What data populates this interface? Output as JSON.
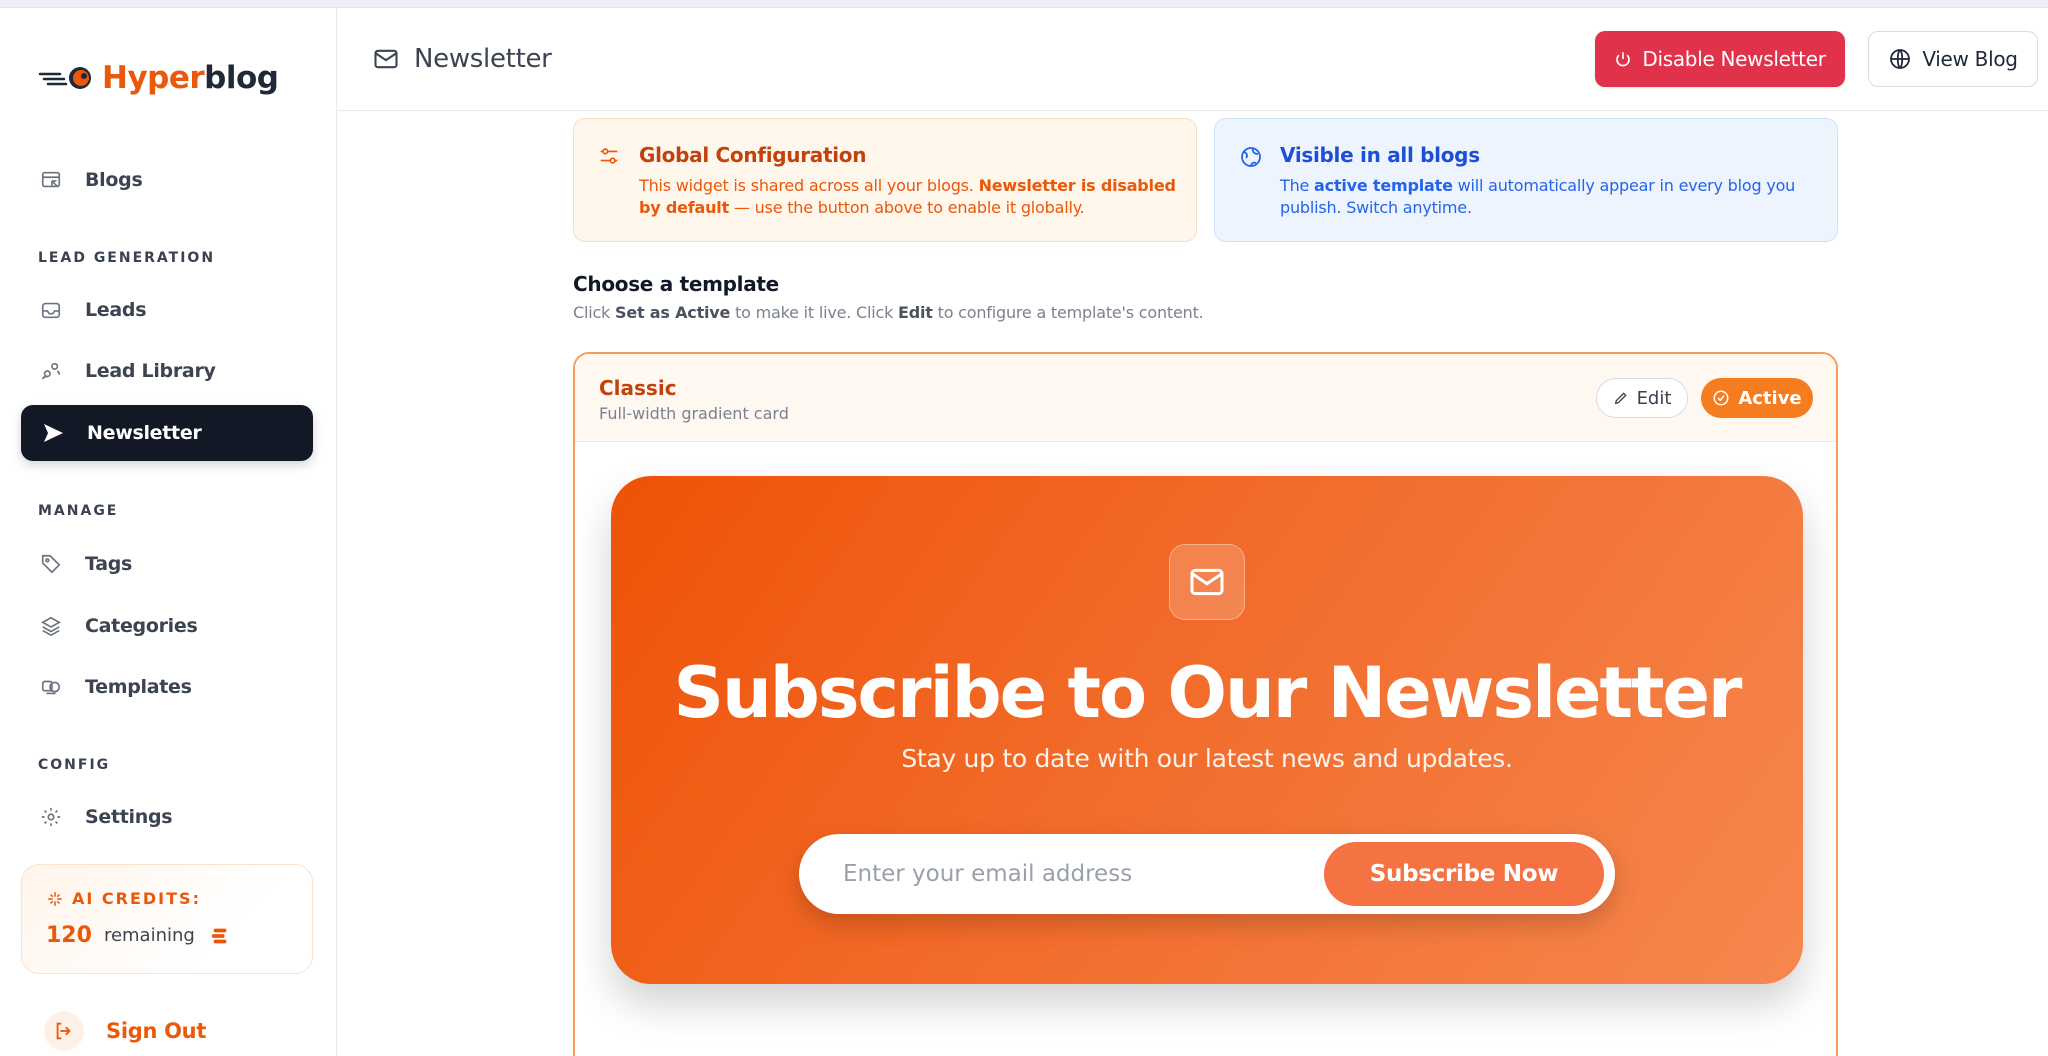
{
  "app": {
    "logo_prefix": "Hyper",
    "logo_suffix": "blog"
  },
  "sidebar": {
    "blogs": "Blogs",
    "sections": {
      "lead_generation": "LEAD GENERATION",
      "manage": "MANAGE",
      "config": "CONFIG"
    },
    "lead_generation_items": [
      {
        "label": "Leads",
        "icon": "inbox-icon"
      },
      {
        "label": "Lead Library",
        "icon": "users-icon"
      },
      {
        "label": "Newsletter",
        "icon": "send-icon",
        "active": true
      }
    ],
    "manage_items": [
      {
        "label": "Tags",
        "icon": "tag-icon"
      },
      {
        "label": "Categories",
        "icon": "layers-icon"
      },
      {
        "label": "Templates",
        "icon": "templates-icon"
      }
    ],
    "config_items": [
      {
        "label": "Settings",
        "icon": "gear-icon"
      }
    ],
    "credits": {
      "title": "AI CREDITS:",
      "count": "120",
      "remaining_label": "remaining"
    },
    "sign_out": "Sign Out"
  },
  "header": {
    "title": "Newsletter",
    "disable_button": "Disable Newsletter",
    "view_blog_button": "View Blog"
  },
  "info_cards": {
    "global": {
      "title": "Global Configuration",
      "body_pre": "This widget is shared across all your blogs. ",
      "body_bold": "Newsletter is disabled by default",
      "body_post": " — use the button above to enable it globally."
    },
    "visible": {
      "title": "Visible in all blogs",
      "body_pre": "The ",
      "body_bold": "active template",
      "body_post": " will automatically appear in every blog you publish. Switch anytime."
    }
  },
  "choose": {
    "title": "Choose a template",
    "sub_1": "Click ",
    "sub_bold_1": "Set as Active",
    "sub_2": " to make it live. Click ",
    "sub_bold_2": "Edit",
    "sub_3": " to configure a template's content."
  },
  "template": {
    "name": "Classic",
    "description": "Full-width gradient card",
    "edit_button": "Edit",
    "active_button": "Active",
    "preview": {
      "title": "Subscribe to Our Newsletter",
      "subtitle": "Stay up to date with our latest news and updates.",
      "email_placeholder": "Enter your email address",
      "subscribe_button": "Subscribe Now"
    }
  },
  "colors": {
    "brand_orange": "#ea580c",
    "danger_red": "#e0324a",
    "sidebar_active": "#121826",
    "info_blue": "#1d4ed8"
  }
}
